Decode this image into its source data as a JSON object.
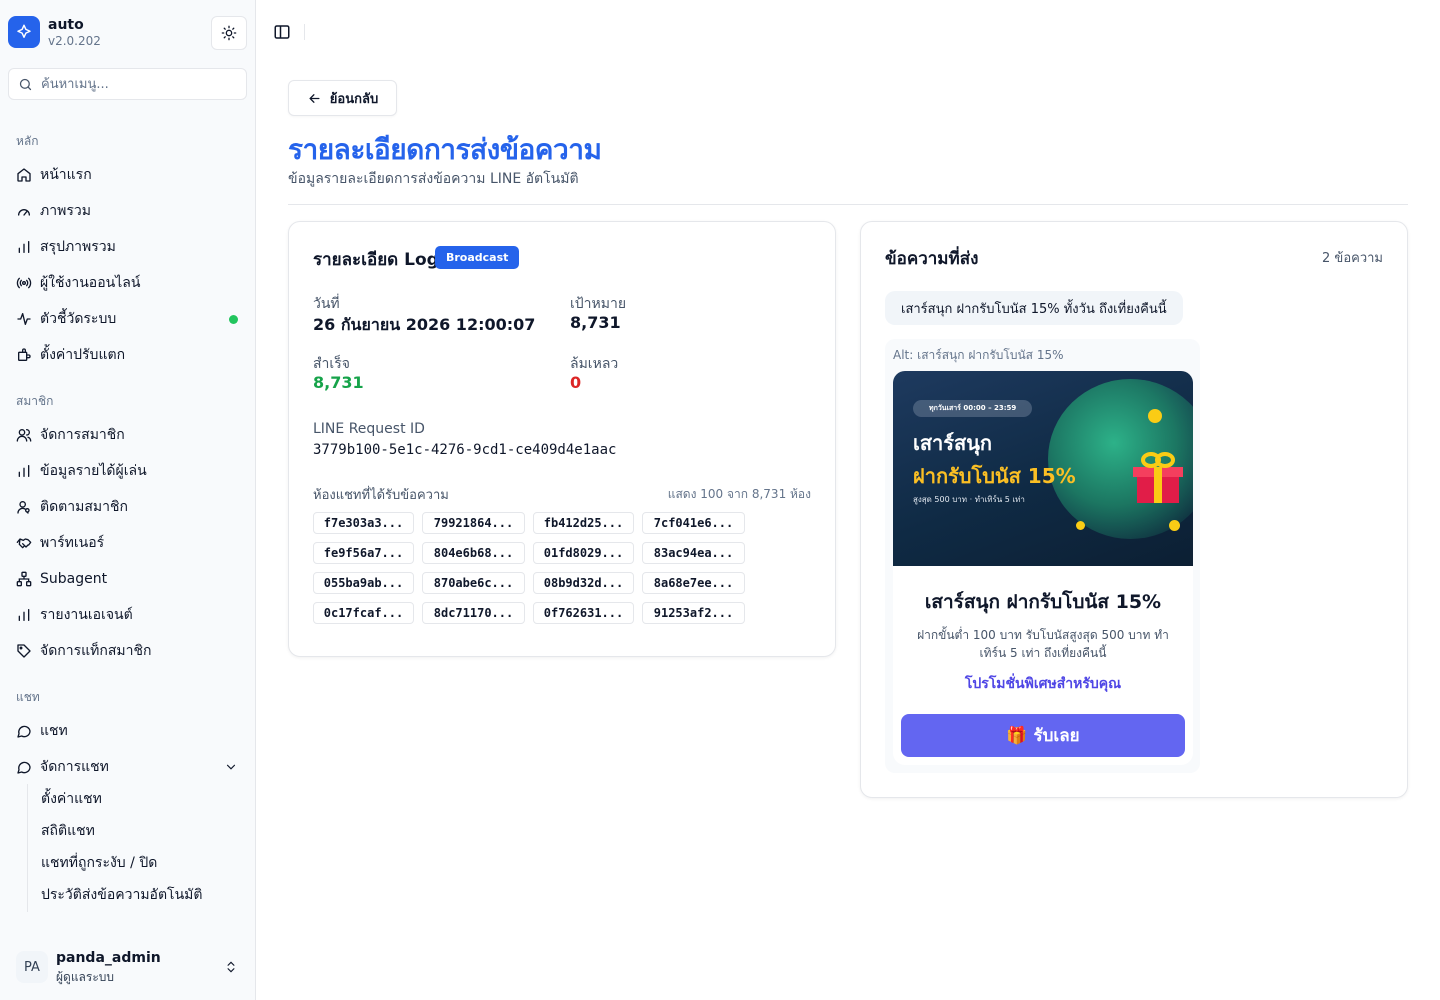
{
  "brand": {
    "name": "auto",
    "version": "v2.0.202"
  },
  "search": {
    "placeholder": "ค้นหาเมนู..."
  },
  "nav": {
    "section_main": "หลัก",
    "home": "หน้าแรก",
    "overview": "ภาพรวม",
    "summary": "สรุปภาพรวม",
    "online_users": "ผู้ใช้งานออนไลน์",
    "system_metrics": "ตัวชี้วัดระบบ",
    "customize": "ตั้งค่าปรับแตก",
    "section_members": "สมาชิก",
    "manage_members": "จัดการสมาชิก",
    "player_income": "ข้อมูลรายได้ผู้เล่น",
    "track_members": "ติดตามสมาชิก",
    "partners": "พาร์ทเนอร์",
    "subagent": "Subagent",
    "agent_report": "รายงานเอเจนต์",
    "member_tags": "จัดการแท็กสมาชิก",
    "section_chat": "แชท",
    "chat": "แชท",
    "manage_chat": "จัดการแชท",
    "chat_settings": "ตั้งค่าแชท",
    "chat_stats": "สถิติแชท",
    "suspended_chats": "แชทที่ถูกระงับ / ปิด",
    "auto_message_history": "ประวัติส่งข้อความอัตโนมัติ"
  },
  "user": {
    "initials": "PA",
    "name": "panda_admin",
    "role": "ผู้ดูแลระบบ"
  },
  "page": {
    "back_label": "ย้อนกลับ",
    "title": "รายละเอียดการส่งข้อความ",
    "subtitle": "ข้อมูลรายละเอียดการส่งข้อความ LINE อัตโนมัติ"
  },
  "log": {
    "title": "รายละเอียด Log",
    "badge": "Broadcast",
    "date_label": "วันที่",
    "date_value": "26 กันยายน 2026 12:00:07",
    "target_label": "เป้าหมาย",
    "target_value": "8,731",
    "success_label": "สำเร็จ",
    "success_value": "8,731",
    "failed_label": "ล้มเหลว",
    "failed_value": "0",
    "request_id_label": "LINE Request ID",
    "request_id_value": "3779b100-5e1c-4276-9cd1-ce409d4e1aac",
    "rooms_label": "ห้องแชทที่ได้รับข้อความ",
    "rooms_count": "แสดง 100 จาก 8,731 ห้อง",
    "rooms": [
      "f7e303a3...",
      "79921864...",
      "fb412d25...",
      "7cf041e6...",
      "fe9f56a7...",
      "804e6b68...",
      "01fd8029...",
      "83ac94ea...",
      "055ba9ab...",
      "870abe6c...",
      "08b9d32d...",
      "8a68e7ee...",
      "0c17fcaf...",
      "8dc71170...",
      "0f762631...",
      "91253af2..."
    ]
  },
  "messages": {
    "title": "ข้อความที่ส่ง",
    "count": "2 ข้อความ",
    "text_message": "เสาร์สนุก ฝากรับโบนัส 15% ทั้งวัน ถึงเที่ยงคืนนี้",
    "alt_text": "Alt: เสาร์สนุก ฝากรับโบนัส 15%",
    "hero_pill": "ทุกวันเสาร์ 00:00 – 23:59",
    "hero_line1": "เสาร์สนุก",
    "hero_line2": "ฝากรับโบนัส 15%",
    "hero_small": "สูงสุด 500 บาท · ทำเทิร์น 5 เท่า",
    "promo_title": "เสาร์สนุก ฝากรับโบนัส 15%",
    "promo_desc": "ฝากขั้นต่ำ 100 บาท รับโบนัสสูงสุด 500 บาท ทำเทิร์น 5 เท่า ถึงเที่ยงคืนนี้",
    "promo_link": "โปรโมชั่นพิเศษสำหรับคุณ",
    "promo_button": "🎁 รับเลย"
  },
  "colors": {
    "primary": "#2563eb",
    "success": "#16a34a",
    "danger": "#dc2626",
    "indigo": "#6366f1"
  }
}
